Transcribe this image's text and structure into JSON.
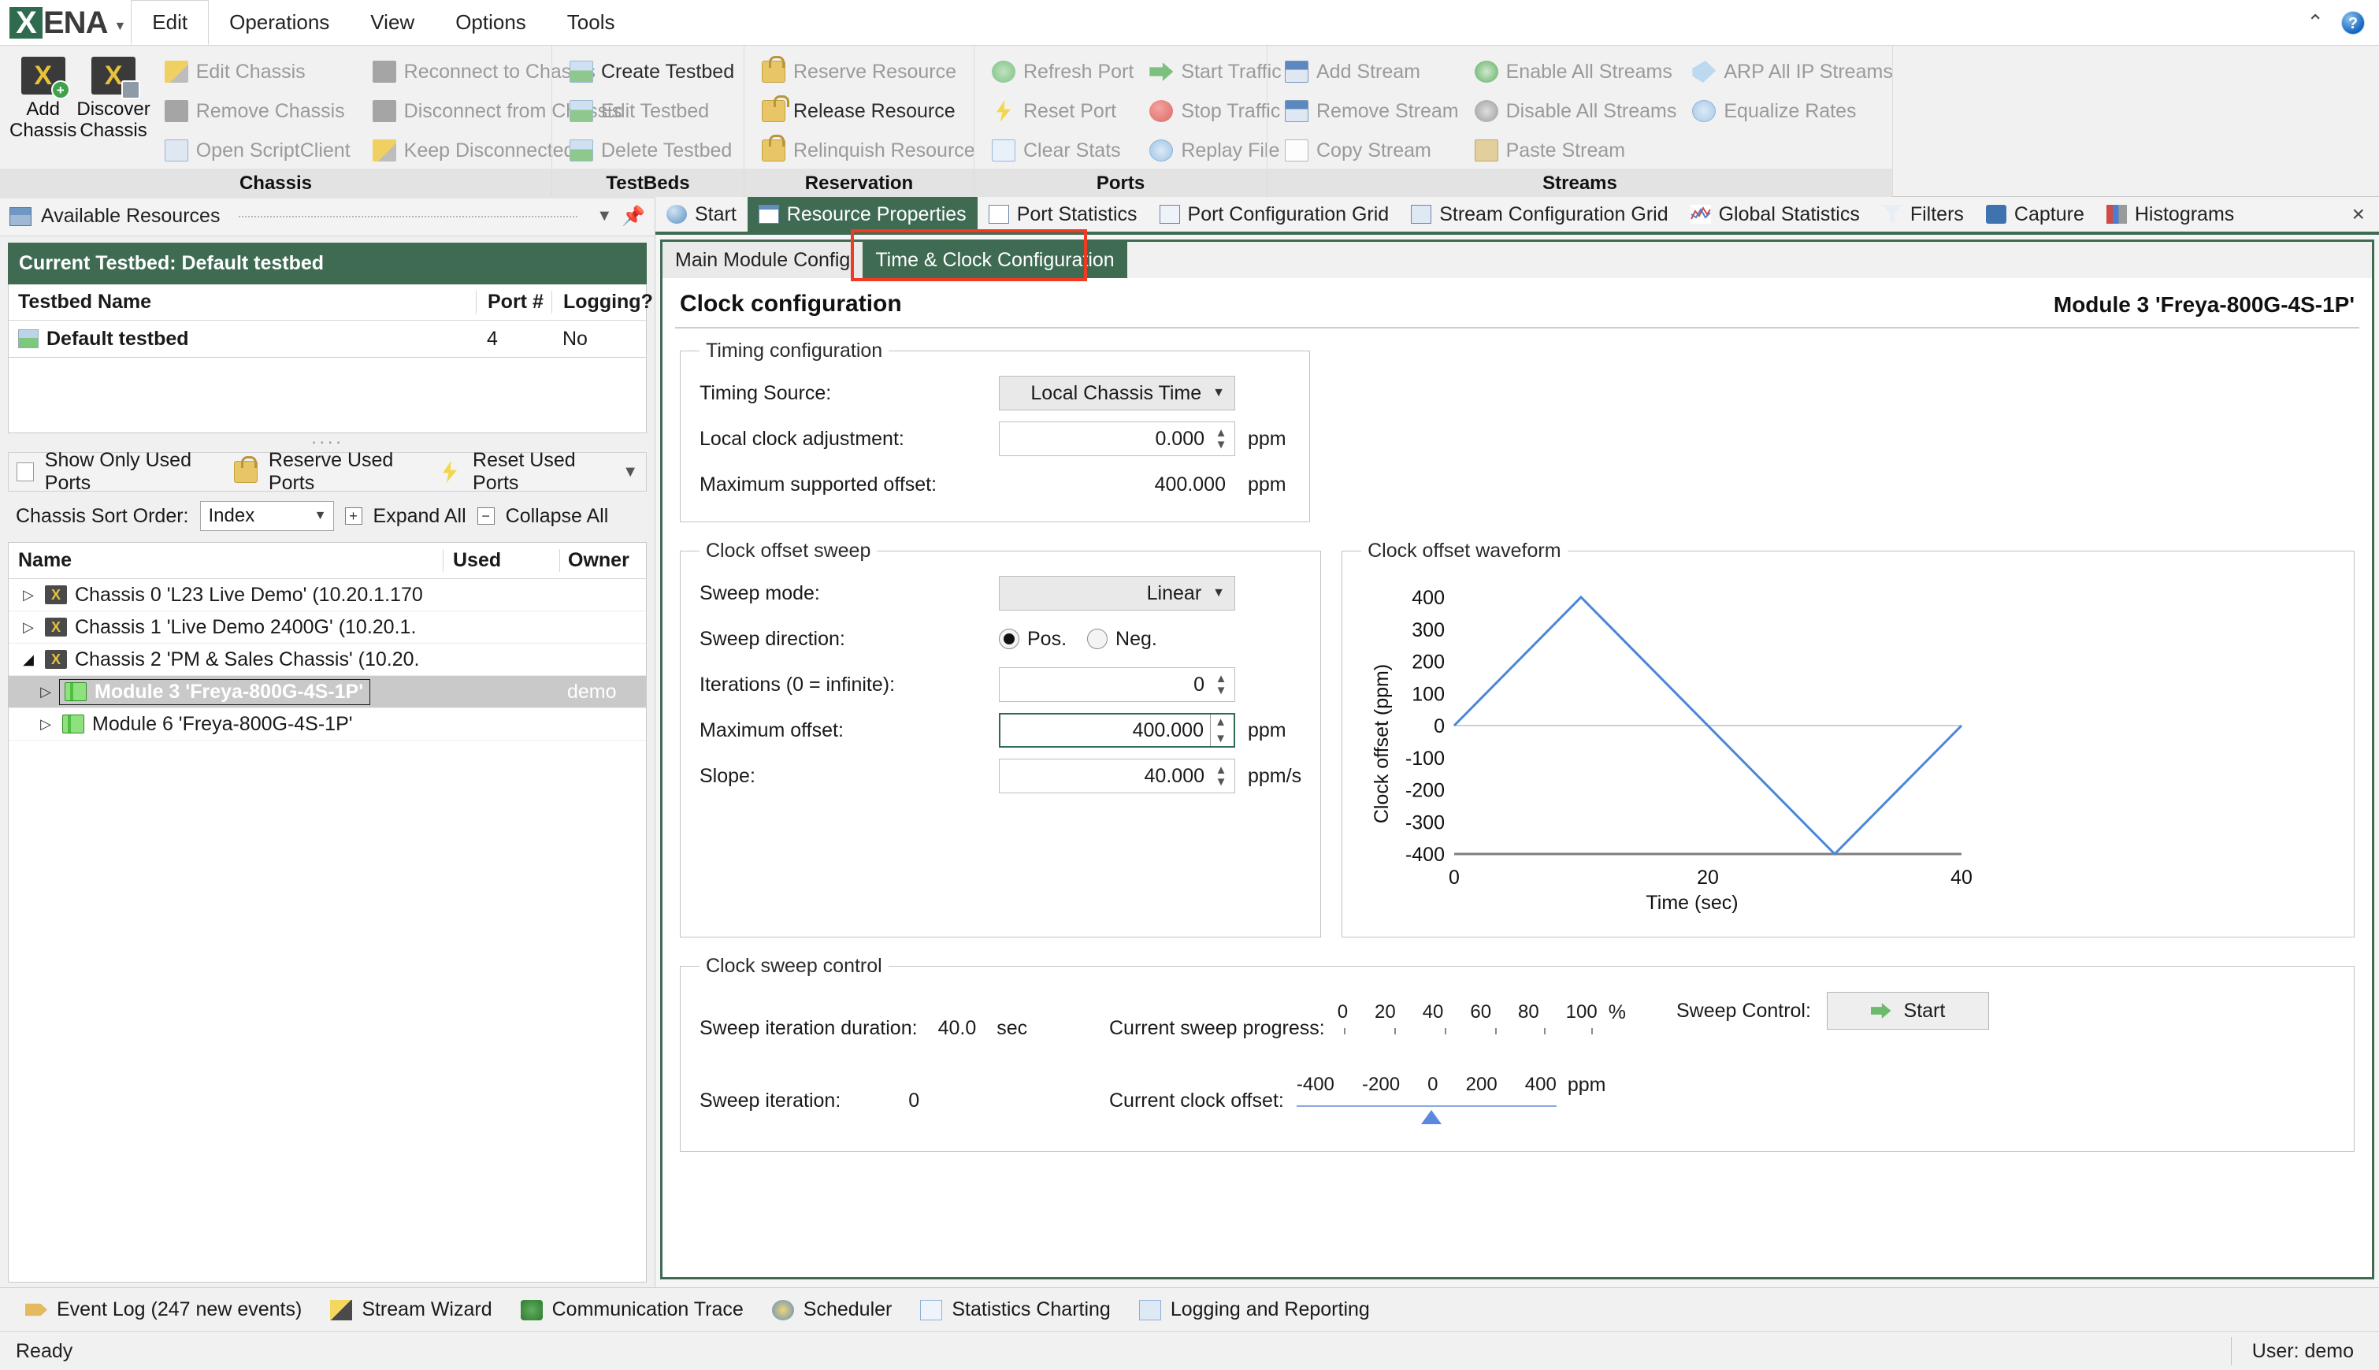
{
  "app": {
    "brand": "XENA",
    "menu": [
      "Edit",
      "Operations",
      "View",
      "Options",
      "Tools"
    ],
    "active_menu": "Edit",
    "window_controls": {
      "collapse": "⌃",
      "help": "?"
    }
  },
  "ribbon": {
    "groups": [
      {
        "label": "Chassis",
        "big_buttons": [
          {
            "label": "Add\nChassis",
            "icon": "add-chassis-icon",
            "enabled": true
          },
          {
            "label": "Discover\nChassis",
            "icon": "discover-chassis-icon",
            "enabled": true
          }
        ],
        "columns": [
          [
            {
              "label": "Edit Chassis",
              "icon": "edit-chassis-icon",
              "enabled": false
            },
            {
              "label": "Remove Chassis",
              "icon": "remove-chassis-icon",
              "enabled": false
            },
            {
              "label": "Open ScriptClient",
              "icon": "script-client-icon",
              "enabled": false
            }
          ],
          [
            {
              "label": "Reconnect to Chassis",
              "icon": "reconnect-icon",
              "enabled": false
            },
            {
              "label": "Disconnect from Chassis",
              "icon": "disconnect-icon",
              "enabled": false
            },
            {
              "label": "Keep Disconnected",
              "icon": "keep-disconnected-icon",
              "enabled": false
            }
          ]
        ]
      },
      {
        "label": "TestBeds",
        "big_buttons": [],
        "columns": [
          [
            {
              "label": "Create Testbed",
              "icon": "create-testbed-icon",
              "enabled": true
            },
            {
              "label": "Edit Testbed",
              "icon": "edit-testbed-icon",
              "enabled": false
            },
            {
              "label": "Delete Testbed",
              "icon": "delete-testbed-icon",
              "enabled": false
            }
          ]
        ]
      },
      {
        "label": "Reservation",
        "big_buttons": [],
        "columns": [
          [
            {
              "label": "Reserve Resource",
              "icon": "lock-closed-icon",
              "enabled": false
            },
            {
              "label": "Release Resource",
              "icon": "lock-open-icon",
              "enabled": true
            },
            {
              "label": "Relinquish Resource",
              "icon": "lock-relinquish-icon",
              "enabled": false
            }
          ]
        ]
      },
      {
        "label": "Ports",
        "big_buttons": [],
        "columns": [
          [
            {
              "label": "Refresh Port",
              "icon": "refresh-icon",
              "enabled": false
            },
            {
              "label": "Reset Port",
              "icon": "bolt-icon",
              "enabled": false
            },
            {
              "label": "Clear Stats",
              "icon": "clear-stats-icon",
              "enabled": false
            }
          ],
          [
            {
              "label": "Start Traffic",
              "icon": "play-arrow-icon",
              "enabled": false
            },
            {
              "label": "Stop Traffic",
              "icon": "stop-icon",
              "enabled": false
            },
            {
              "label": "Replay File",
              "icon": "replay-icon",
              "enabled": false
            }
          ]
        ]
      },
      {
        "label": "Streams",
        "big_buttons": [],
        "columns": [
          [
            {
              "label": "Add Stream",
              "icon": "add-stream-icon",
              "enabled": false
            },
            {
              "label": "Remove Stream",
              "icon": "remove-stream-icon",
              "enabled": false
            },
            {
              "label": "Copy Stream",
              "icon": "copy-icon",
              "enabled": false
            }
          ],
          [
            {
              "label": "Enable All Streams",
              "icon": "check-circle-icon",
              "enabled": false
            },
            {
              "label": "Disable All Streams",
              "icon": "minus-circle-icon",
              "enabled": false
            },
            {
              "label": "Paste Stream",
              "icon": "paste-icon",
              "enabled": false
            }
          ],
          [
            {
              "label": "ARP All IP Streams",
              "icon": "tag-icon",
              "enabled": false
            },
            {
              "label": "Equalize Rates",
              "icon": "equalize-icon",
              "enabled": false
            }
          ]
        ]
      }
    ]
  },
  "left_dock": {
    "title": "Available Resources",
    "icon": "resources-icon",
    "dropdown_icon": "chevron-down-icon",
    "pin_icon": "pin-icon",
    "current_testbed_banner": "Current Testbed:  Default testbed",
    "testbed_table": {
      "headers": [
        "Testbed Name",
        "Port #",
        "Logging?"
      ],
      "rows": [
        [
          "Default testbed",
          "4",
          "No"
        ]
      ]
    },
    "options": {
      "show_only_used_ports": "Show Only Used Ports",
      "reserve_used_ports": "Reserve Used Ports",
      "reset_used_ports": "Reset Used Ports",
      "overflow_icon": "overflow-chevron-icon"
    },
    "sort": {
      "label": "Chassis Sort Order:",
      "value": "Index",
      "expand_all": "Expand All",
      "collapse_all": "Collapse All"
    },
    "tree": {
      "headers": [
        "Name",
        "Used",
        "",
        "Owner"
      ],
      "rows": [
        {
          "label": "Chassis 0 'L23 Live Demo' (10.20.1.170",
          "kind": "chassis",
          "expanded": false,
          "indent": 0,
          "owner": "",
          "selected": false
        },
        {
          "label": "Chassis 1 'Live Demo 2400G' (10.20.1.",
          "kind": "chassis",
          "expanded": false,
          "indent": 0,
          "owner": "",
          "selected": false
        },
        {
          "label": "Chassis 2 'PM & Sales Chassis' (10.20.",
          "kind": "chassis",
          "expanded": true,
          "indent": 0,
          "owner": "",
          "selected": false
        },
        {
          "label": "Module 3 'Freya-800G-4S-1P'",
          "kind": "module",
          "expanded": false,
          "indent": 1,
          "owner": "demo",
          "selected": true
        },
        {
          "label": "Module 6 'Freya-800G-4S-1P'",
          "kind": "module",
          "expanded": false,
          "indent": 1,
          "owner": "",
          "selected": false
        }
      ]
    }
  },
  "tabs": {
    "items": [
      {
        "label": "Start",
        "icon": "info-icon",
        "active": false
      },
      {
        "label": "Resource Properties",
        "icon": "properties-icon",
        "active": true
      },
      {
        "label": "Port Statistics",
        "icon": "statistics-icon",
        "active": false
      },
      {
        "label": "Port Configuration Grid",
        "icon": "port-grid-icon",
        "active": false
      },
      {
        "label": "Stream Configuration Grid",
        "icon": "stream-grid-icon",
        "active": false
      },
      {
        "label": "Global Statistics",
        "icon": "global-statistics-icon",
        "active": false
      },
      {
        "label": "Filters",
        "icon": "filter-icon",
        "active": false
      },
      {
        "label": "Capture",
        "icon": "capture-icon",
        "active": false
      },
      {
        "label": "Histograms",
        "icon": "histogram-icon",
        "active": false
      }
    ],
    "close_icon": "×"
  },
  "panel": {
    "subtabs": [
      {
        "label": "Main Module Config",
        "active": false
      },
      {
        "label": "Time & Clock Configuration",
        "active": true
      }
    ],
    "title": "Clock configuration",
    "module": "Module 3 'Freya-800G-4S-1P'",
    "timing": {
      "legend": "Timing configuration",
      "timing_source_label": "Timing Source:",
      "timing_source_value": "Local Chassis Time",
      "local_clock_adjustment_label": "Local clock adjustment:",
      "local_clock_adjustment_value": "0.000",
      "local_clock_adjustment_unit": "ppm",
      "max_supported_offset_label": "Maximum supported offset:",
      "max_supported_offset_value": "400.000",
      "max_supported_offset_unit": "ppm"
    },
    "sweep": {
      "legend": "Clock offset sweep",
      "sweep_mode_label": "Sweep mode:",
      "sweep_mode_value": "Linear",
      "sweep_direction_label": "Sweep direction:",
      "direction_pos": "Pos.",
      "direction_neg": "Neg.",
      "direction_selected": "Pos.",
      "iterations_label": "Iterations (0 = infinite):",
      "iterations_value": "0",
      "max_offset_label": "Maximum offset:",
      "max_offset_value": "400.000",
      "max_offset_unit": "ppm",
      "slope_label": "Slope:",
      "slope_value": "40.000",
      "slope_unit": "ppm/s"
    },
    "waveform": {
      "legend": "Clock offset waveform"
    },
    "control": {
      "legend": "Clock sweep control",
      "duration_label": "Sweep iteration duration:",
      "duration_value": "40.0",
      "duration_unit": "sec",
      "iteration_label": "Sweep iteration:",
      "iteration_value": "0",
      "progress_label": "Current sweep progress:",
      "progress_ticks": [
        "0",
        "20",
        "40",
        "60",
        "80",
        "100"
      ],
      "progress_unit": "%",
      "offset_label": "Current clock offset:",
      "offset_ticks": [
        "-400",
        "-200",
        "0",
        "200",
        "400"
      ],
      "offset_unit": "ppm",
      "offset_marker_value": "0",
      "sweep_control_label": "Sweep Control:",
      "start_button": "Start",
      "start_icon": "play-arrow-icon"
    }
  },
  "chart_data": {
    "type": "line",
    "title": "Clock offset waveform",
    "xlabel": "Time (sec)",
    "ylabel": "Clock offset (ppm)",
    "xlim": [
      0,
      40
    ],
    "ylim": [
      -400,
      400
    ],
    "xticks": [
      0,
      20,
      40
    ],
    "yticks": [
      -400,
      -300,
      -200,
      -100,
      0,
      100,
      200,
      300,
      400
    ],
    "grid": false,
    "legend": "none",
    "line_color": "#4a86d8",
    "series": [
      {
        "name": "Clock offset",
        "x": [
          0,
          10,
          30,
          40
        ],
        "y": [
          0,
          400,
          -400,
          0
        ]
      }
    ]
  },
  "bottom_bar": {
    "items": [
      {
        "label": "Event Log (247 new events)",
        "icon": "event-log-icon"
      },
      {
        "label": "Stream Wizard",
        "icon": "wizard-icon"
      },
      {
        "label": "Communication Trace",
        "icon": "trace-icon"
      },
      {
        "label": "Scheduler",
        "icon": "scheduler-icon"
      },
      {
        "label": "Statistics Charting",
        "icon": "charting-icon"
      },
      {
        "label": "Logging and Reporting",
        "icon": "reporting-icon"
      }
    ]
  },
  "status_bar": {
    "left": "Ready",
    "right": "User: demo"
  }
}
